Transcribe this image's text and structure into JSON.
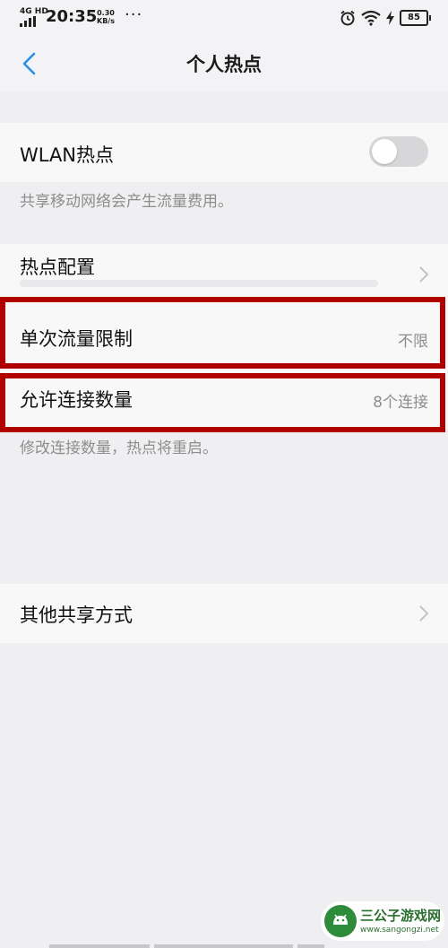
{
  "status_bar": {
    "network": "4G HD",
    "time": "20:35",
    "speed_value": "0.30",
    "speed_unit": "KB/s",
    "more": "···",
    "battery": "85",
    "icons": [
      "signal-icon",
      "alarm-icon",
      "wifi-icon",
      "charging-icon",
      "battery-icon"
    ]
  },
  "header": {
    "back_icon": "chevron-left-icon",
    "title": "个人热点"
  },
  "wlan": {
    "label": "WLAN热点",
    "enabled": false,
    "hint": "共享移动网络会产生流量费用。"
  },
  "hotspot_config": {
    "label": "热点配置"
  },
  "single_limit": {
    "label": "单次流量限制",
    "value": "不限"
  },
  "connections": {
    "label": "允许连接数量",
    "value": "8个连接",
    "hint": "修改连接数量，热点将重启。"
  },
  "other_sharing": {
    "label": "其他共享方式"
  },
  "watermark": {
    "name": "三公子游戏网",
    "url": "www.sangongzi.net"
  },
  "colors": {
    "accent": "#2a8fe8",
    "highlight": "#b00000",
    "background": "#efeff1",
    "row": "#f8f8f9"
  }
}
